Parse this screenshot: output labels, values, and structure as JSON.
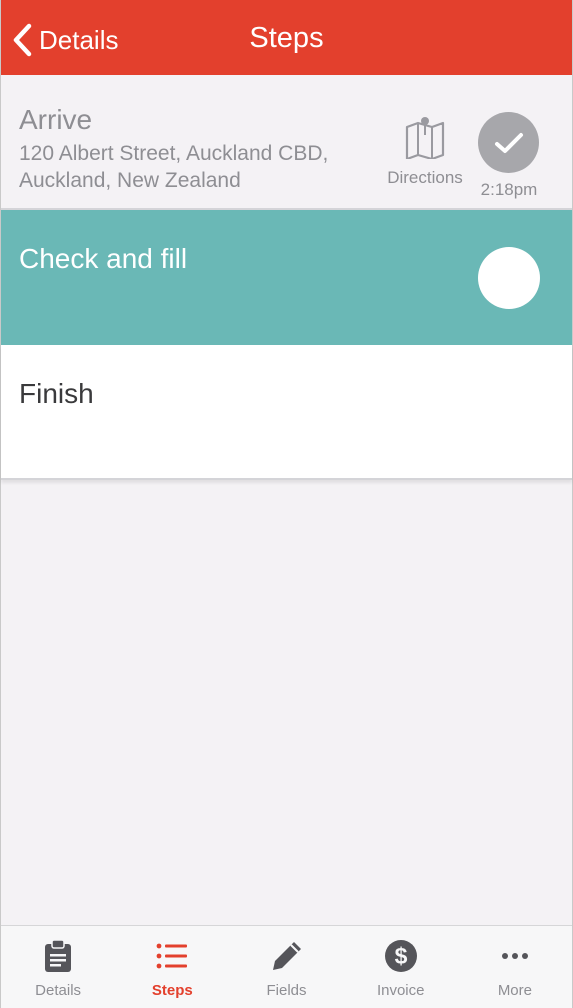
{
  "header": {
    "back_label": "Details",
    "title": "Steps"
  },
  "steps": [
    {
      "title": "Arrive",
      "address": "120 Albert Street, Auckland CBD, Auckland, New Zealand",
      "directions_label": "Directions",
      "completed_time": "2:18pm",
      "state": "completed"
    },
    {
      "title": "Check and fill",
      "state": "current"
    },
    {
      "title": "Finish",
      "state": "pending"
    }
  ],
  "tabs": [
    {
      "label": "Details",
      "icon": "clipboard-icon",
      "active": false
    },
    {
      "label": "Steps",
      "icon": "list-icon",
      "active": true
    },
    {
      "label": "Fields",
      "icon": "pencil-icon",
      "active": false
    },
    {
      "label": "Invoice",
      "icon": "dollar-icon",
      "active": false
    },
    {
      "label": "More",
      "icon": "more-icon",
      "active": false
    }
  ],
  "colors": {
    "header": "#e3402d",
    "current_step": "#6ab8b6",
    "tab_active": "#e3402d",
    "muted_text": "#8e8e93"
  }
}
